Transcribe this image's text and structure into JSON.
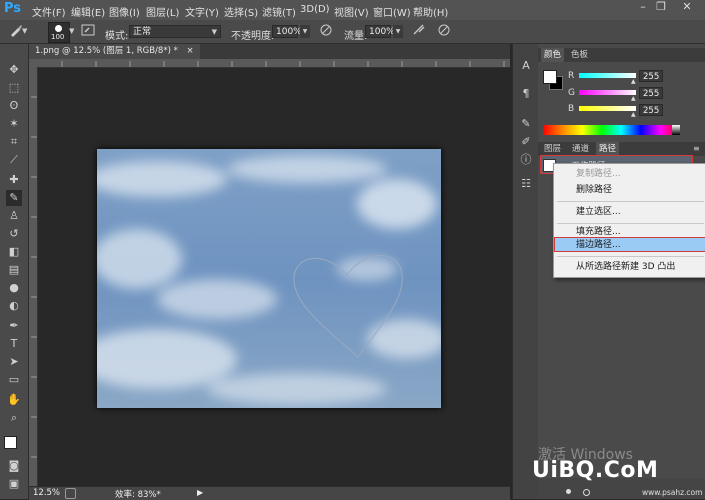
{
  "app": {
    "logo": "Ps"
  },
  "menu": [
    "文件(F)",
    "编辑(E)",
    "图像(I)",
    "图层(L)",
    "文字(Y)",
    "选择(S)",
    "滤镜(T)",
    "3D(D)",
    "视图(V)",
    "窗口(W)",
    "帮助(H)"
  ],
  "window_controls": {
    "minimize": "–",
    "restore": "❐",
    "close": "✕"
  },
  "options": {
    "brush_size": "100",
    "mode_label": "模式:",
    "mode_value": "正常",
    "opacity_label": "不透明度:",
    "opacity_value": "100%",
    "flow_label": "流量:",
    "flow_value": "100%"
  },
  "document": {
    "tab_title": "1.png @ 12.5% (图层 1, RGB/8*) *",
    "tab_close": "×",
    "zoom": "12.5%",
    "efficiency": "效率: 83%*"
  },
  "color_panel": {
    "tabs": [
      "颜色",
      "色板"
    ],
    "channels": [
      {
        "label": "R",
        "value": "255"
      },
      {
        "label": "G",
        "value": "255"
      },
      {
        "label": "B",
        "value": "255"
      }
    ]
  },
  "layers_panel": {
    "tabs": [
      "图层",
      "通道",
      "路径"
    ],
    "path_name": "工作路径"
  },
  "context_menu": {
    "items": [
      "复制路径...",
      "删除路径",
      "建立选区...",
      "填充路径...",
      "描边路径...",
      "从所选路径新建 3D 凸出"
    ]
  },
  "watermark": {
    "activate": "激活 Windows",
    "logo": "UiBQ.CoM",
    "url": "www.psahz.com"
  },
  "colors": {
    "accent_red": "#d23a3a",
    "menu_highlight": "#99cbf5",
    "ps_blue": "#31a8ff"
  }
}
